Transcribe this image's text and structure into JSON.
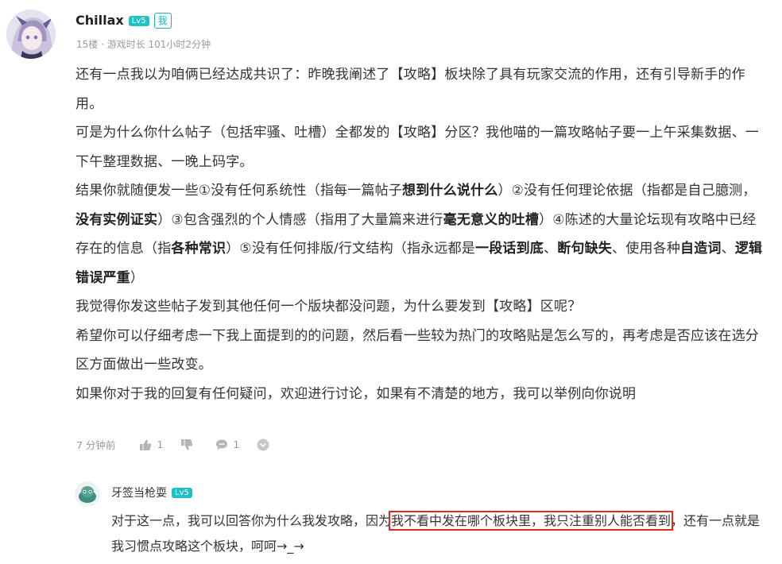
{
  "comment": {
    "username": "Chillax",
    "level": "Lv5",
    "me_tag": "我",
    "meta": "15楼 · 游戏时长 101小时2分钟",
    "paragraphs": [
      [
        {
          "t": "还有一点我以为咱俩已经达成共识了：昨晚我阐述了【攻略】板块除了具有玩家交流的作用，还有引导新手的作用。"
        }
      ],
      [
        {
          "t": "可是为什么你什么帖子（包括牢骚、吐槽）全都发的【攻略】分区？我他喵的一篇攻略帖子要一上午采集数据、一下午整理数据、一晚上码字。"
        }
      ],
      [
        {
          "t": "结果你就随便发一些①没有任何系统性（指每一篇帖子"
        },
        {
          "t": "想到什么说什么",
          "b": true
        },
        {
          "t": "）②没有任何理论依据（指都是自己臆测，"
        },
        {
          "t": "没有实例证实",
          "b": true
        },
        {
          "t": "）③包含强烈的个人情感（指用了大量篇来进行"
        },
        {
          "t": "毫无意义的吐槽",
          "b": true
        },
        {
          "t": "）④陈述的大量论坛现有攻略中已经存在的信息（指"
        },
        {
          "t": "各种常识",
          "b": true
        },
        {
          "t": "）⑤没有任何排版/行文结构（指永远都是"
        },
        {
          "t": "一段话到底",
          "b": true
        },
        {
          "t": "、"
        },
        {
          "t": "断句缺失",
          "b": true
        },
        {
          "t": "、使用各种"
        },
        {
          "t": "自造词",
          "b": true
        },
        {
          "t": "、"
        },
        {
          "t": "逻辑错误严重",
          "b": true
        },
        {
          "t": "）"
        }
      ],
      [
        {
          "t": "我觉得你发这些帖子发到其他任何一个版块都没问题，为什么要发到【攻略】区呢？"
        }
      ],
      [
        {
          "t": "希望你可以仔细考虑一下我上面提到的的问题，然后看一些较为热门的攻略贴是怎么写的，再考虑是否应该在选分区方面做出一些改变。"
        }
      ],
      [
        {
          "t": "如果你对于我的回复有任何疑问，欢迎进行讨论，如果有不清楚的地方，我可以举例向你说明"
        }
      ]
    ],
    "time": "7 分钟前",
    "likes": "1",
    "replies": "1"
  },
  "reply": {
    "username": "牙签当枪耍",
    "level": "Lv5",
    "text_before": "对于这一点，我可以回答你为什么我发攻略，因为",
    "text_highlight": "我不看中发在哪个板块里，我只注重别人能否看到",
    "text_after": "，还有一点就是我习惯点攻略这个板块，呵呵→_→"
  },
  "colors": {
    "accent": "#1ec1c6",
    "highlight": "#e8281d",
    "meta": "#999999"
  }
}
